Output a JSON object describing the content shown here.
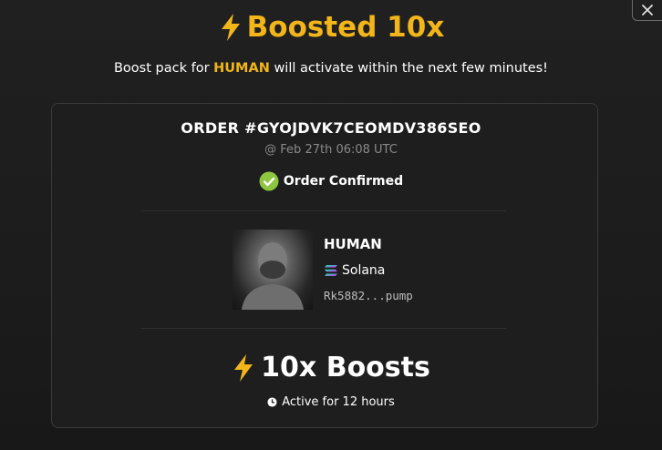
{
  "header": {
    "title": "Boosted 10x",
    "subtitle_prefix": "Boost pack for",
    "subtitle_token": "HUMAN",
    "subtitle_suffix": "will activate within the next few minutes!"
  },
  "order": {
    "id_label": "ORDER #GYOJDVK7CEOMDV386SEO",
    "timestamp": "@ Feb 27th 06:08 UTC",
    "status": "Order Confirmed"
  },
  "token": {
    "name": "HUMAN",
    "chain": "Solana",
    "address": "Rk5882...pump"
  },
  "boost": {
    "amount_label": "10x Boosts",
    "duration": "Active for 12 hours"
  },
  "colors": {
    "accent": "#f2b51a",
    "success": "#8ec63f",
    "background": "#1e1e1e"
  },
  "icons": [
    "close-icon",
    "lightning-icon",
    "check-circle-icon",
    "solana-icon",
    "clock-icon"
  ]
}
